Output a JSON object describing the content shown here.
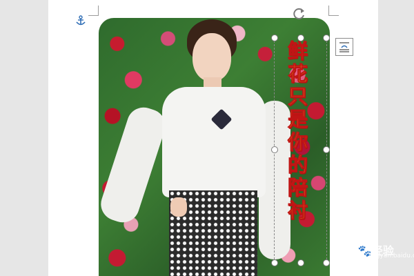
{
  "document": {
    "caption_text": "鲜花只是你的陪衬",
    "watermark_text": "Bai🐾经验",
    "watermark_sub": "jingyan.baidu.com"
  },
  "colors": {
    "caption_fill": "#f5d511",
    "caption_outline": "#c01515",
    "page_bg": "#ffffff",
    "canvas_bg": "#e6e6e6"
  },
  "icons": {
    "anchor": "anchor-icon",
    "rotate": "rotate-handle-icon",
    "layout_options": "layout-options-icon"
  }
}
